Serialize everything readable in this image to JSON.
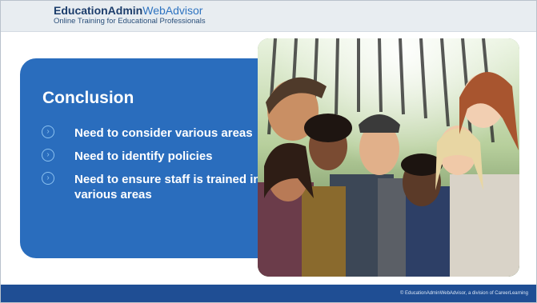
{
  "header": {
    "brand_bold": "EducationAdmin",
    "brand_light": "WebAdvisor",
    "tagline": "Online Training for Educational Professionals"
  },
  "slide": {
    "title": "Conclusion",
    "bullets": [
      "Need to consider various areas",
      "Need to identify policies",
      "Need to ensure staff is trained in various areas"
    ]
  },
  "footer": {
    "copyright": "© EducationAdminWebAdvisor, a division of CareerLearning"
  },
  "icons": {
    "bullet": "chevron-right-circle-icon"
  },
  "colors": {
    "panel": "#2a6dbd",
    "footer": "#1f4e94",
    "header": "#e8edf1",
    "brand": "#1c3d6b",
    "brand_light": "#2e73c0"
  }
}
